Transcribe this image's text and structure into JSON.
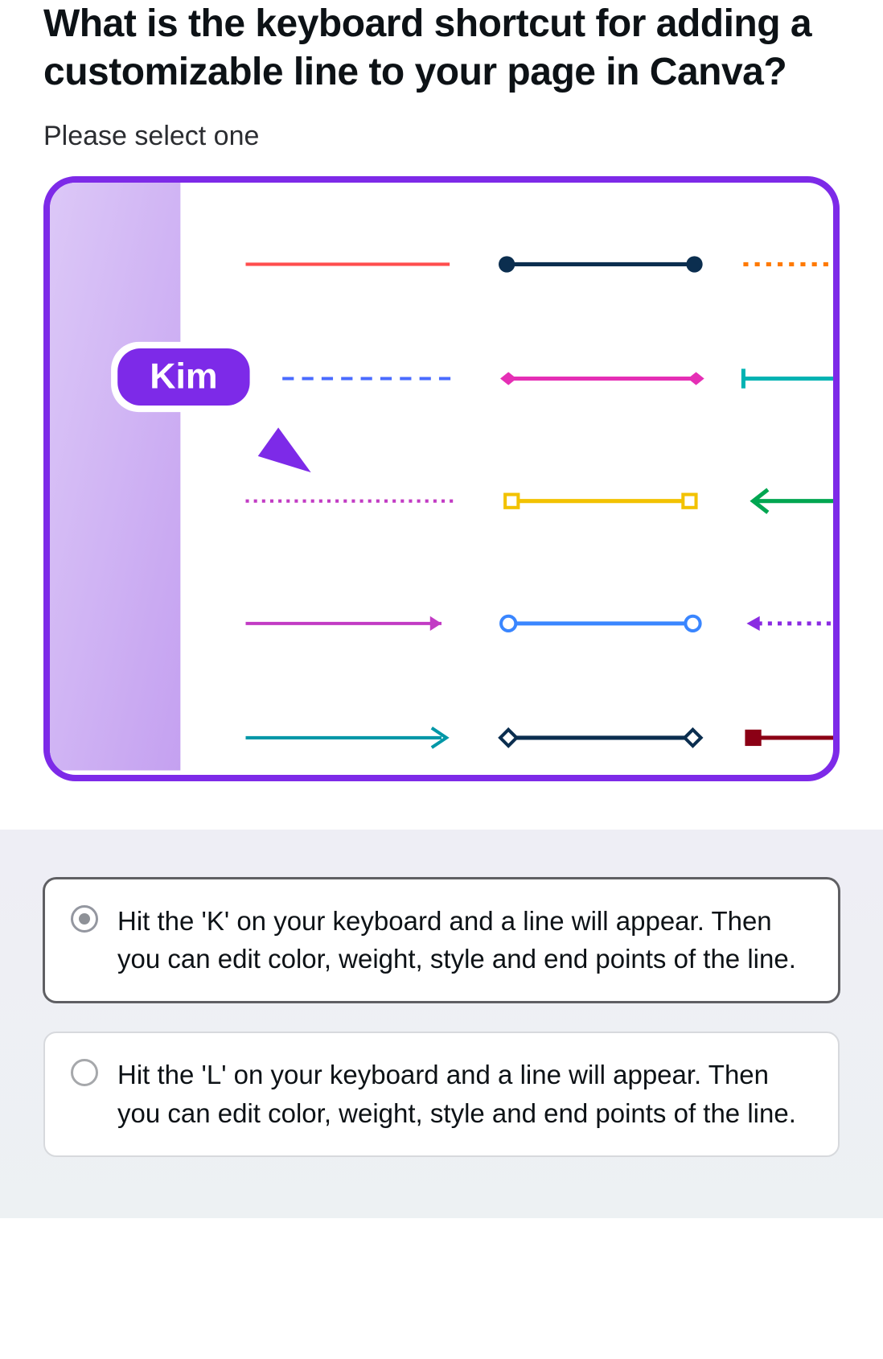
{
  "question": {
    "title": "What is the keyboard shortcut for adding a customizable line to your page in Canva?",
    "instruction": "Please select one"
  },
  "illustration": {
    "cursor_label": "Kim"
  },
  "answers": [
    {
      "text": "Hit the 'K' on your keyboard and a line will appear. Then you can edit color, weight, style and end points of the line.",
      "selected": true
    },
    {
      "text": "Hit the 'L' on your keyboard and a line will appear. Then you can edit color, weight, style and end points of the line.",
      "selected": false
    }
  ]
}
